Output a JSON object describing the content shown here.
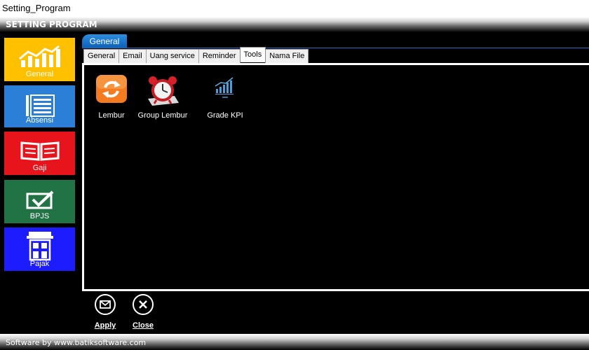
{
  "window": {
    "title": "Setting_Program"
  },
  "header": {
    "title": "SETTING PROGRAM"
  },
  "sidebar": {
    "items": [
      {
        "label": "General",
        "icon": "line-chart-icon",
        "color": "#ffc000"
      },
      {
        "label": "Absensi",
        "icon": "list-icon",
        "color": "#2b7fd6"
      },
      {
        "label": "Gaji",
        "icon": "book-icon",
        "color": "#e8141c"
      },
      {
        "label": "BPJS",
        "icon": "checkmark-envelope-icon",
        "color": "#217346"
      },
      {
        "label": "Pajak",
        "icon": "building-icon",
        "color": "#1c1cff"
      }
    ]
  },
  "main": {
    "group_tab": "General",
    "tabs": [
      {
        "label": "General"
      },
      {
        "label": "Email"
      },
      {
        "label": "Uang service"
      },
      {
        "label": "Reminder"
      },
      {
        "label": "Tools",
        "active": true
      },
      {
        "label": "Nama File"
      }
    ],
    "tools": [
      {
        "label": "Lembur",
        "icon": "refresh-icon"
      },
      {
        "label": "Group Lembur",
        "icon": "alarm-clock-icon"
      },
      {
        "label": "Grade KPI",
        "icon": "kpi-chart-icon"
      }
    ]
  },
  "buttons": {
    "apply": {
      "label": "Apply",
      "icon": "envelope-icon"
    },
    "close": {
      "label": "Close",
      "icon": "close-icon"
    }
  },
  "footer": {
    "text": "Software by www.batiksoftware.com"
  }
}
